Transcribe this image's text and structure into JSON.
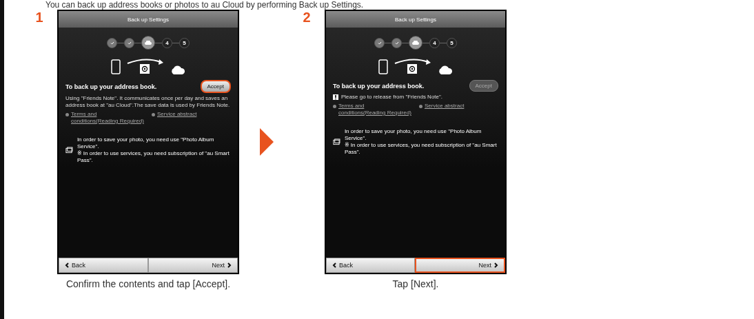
{
  "intro": "You can back up address books or photos to au Cloud by performing Back up Settings.",
  "steps": [
    {
      "number": "1",
      "screen": {
        "title": "Back up Settings",
        "progress": [
          {
            "kind": "done"
          },
          {
            "kind": "done"
          },
          {
            "kind": "current"
          },
          {
            "kind": "pending",
            "label": "4"
          },
          {
            "kind": "pending",
            "label": "5"
          }
        ],
        "heading": "To back up your address book.",
        "accept": {
          "label": "Accept",
          "disabled": false,
          "highlighted": true
        },
        "notice": {
          "kind": "info",
          "text": "Using \"Friends Note\". It communicates once per day and saves an address book at \"au Cloud\".The save data is used by Friends Note."
        },
        "links": [
          "Terms and conditions(Reading Required)",
          "Service abstract"
        ],
        "photo_lines": [
          "In order to save your photo, you need use \"Photo Album Service\".",
          "※ In order to use services, you need subscription of \"au Smart Pass\"."
        ],
        "back": "Back",
        "next": "Next",
        "next_highlighted": false
      },
      "caption": "Confirm the contents and tap [Accept]."
    },
    {
      "number": "2",
      "screen": {
        "title": "Back up Settings",
        "progress": [
          {
            "kind": "done"
          },
          {
            "kind": "done"
          },
          {
            "kind": "current"
          },
          {
            "kind": "pending",
            "label": "4"
          },
          {
            "kind": "pending",
            "label": "5"
          }
        ],
        "heading": "To back up your address book.",
        "accept": {
          "label": "Accept",
          "disabled": true,
          "highlighted": false
        },
        "notice": {
          "kind": "warning",
          "text": "Please go to release from \"Friends Note\"."
        },
        "links": [
          "Terms and conditions(Reading Required)",
          "Service abstract"
        ],
        "photo_lines": [
          "In order to save your photo, you need use \"Photo Album Service\".",
          "※ In order to use services, you need subscription of \"au Smart Pass\"."
        ],
        "back": "Back",
        "next": "Next",
        "next_highlighted": true
      },
      "caption": "Tap [Next]."
    }
  ]
}
